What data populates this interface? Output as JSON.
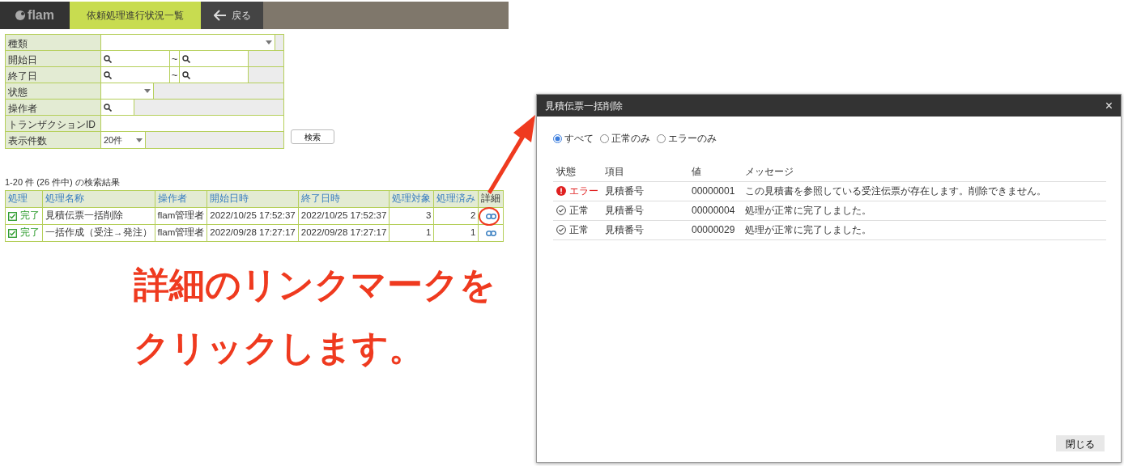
{
  "header": {
    "logo": "flam",
    "title": "依頼処理進行状況一覧",
    "back_button": "戻る"
  },
  "search_form": {
    "fields": [
      {
        "label": "種類",
        "kind": "select"
      },
      {
        "label": "開始日",
        "kind": "range",
        "separator": "~"
      },
      {
        "label": "終了日",
        "kind": "range",
        "separator": "~"
      },
      {
        "label": "状態",
        "kind": "short_select"
      },
      {
        "label": "操作者",
        "kind": "search"
      },
      {
        "label": "トランザクションID",
        "kind": "text"
      },
      {
        "label": "表示件数",
        "kind": "short_select",
        "value": "20件"
      }
    ],
    "search_button": "検索"
  },
  "result_summary": "1-20 件 (26 件中) の検索結果",
  "table": {
    "columns": [
      "処理",
      "処理名称",
      "操作者",
      "開始日時",
      "終了日時",
      "処理対象",
      "処理済み",
      "詳細"
    ],
    "rows": [
      {
        "status": "完了",
        "checked": true,
        "name": "見積伝票一括削除",
        "operator": "flam管理者",
        "start": "2022/10/25 17:52:37",
        "end": "2022/10/25 17:52:37",
        "targets": "3",
        "processed": "2",
        "highlighted": true
      },
      {
        "status": "完了",
        "checked": true,
        "name": "一括作成（受注→発注）",
        "operator": "flam管理者",
        "start": "2022/09/28 17:27:17",
        "end": "2022/09/28 17:27:17",
        "targets": "1",
        "processed": "1",
        "highlighted": false
      }
    ]
  },
  "annotation": {
    "lines": [
      "詳細のリンクマークを",
      "クリックします。"
    ]
  },
  "dialog": {
    "title": "見積伝票一括削除",
    "close": "×",
    "filters": [
      {
        "label": "すべて",
        "selected": true
      },
      {
        "label": "正常のみ",
        "selected": false
      },
      {
        "label": "エラーのみ",
        "selected": false
      }
    ],
    "columns": [
      "状態",
      "項目",
      "値",
      "メッセージ"
    ],
    "rows": [
      {
        "kind": "error",
        "status": "エラー",
        "item": "見積番号",
        "value": "00000001",
        "message": "この見積書を参照している受注伝票が存在します。削除できません。"
      },
      {
        "kind": "ok",
        "status": "正常",
        "item": "見積番号",
        "value": "00000004",
        "message": "処理が正常に完了しました。"
      },
      {
        "kind": "ok",
        "status": "正常",
        "item": "見積番号",
        "value": "00000029",
        "message": "処理が正常に完了しました。"
      }
    ],
    "close_button": "閉じる"
  }
}
